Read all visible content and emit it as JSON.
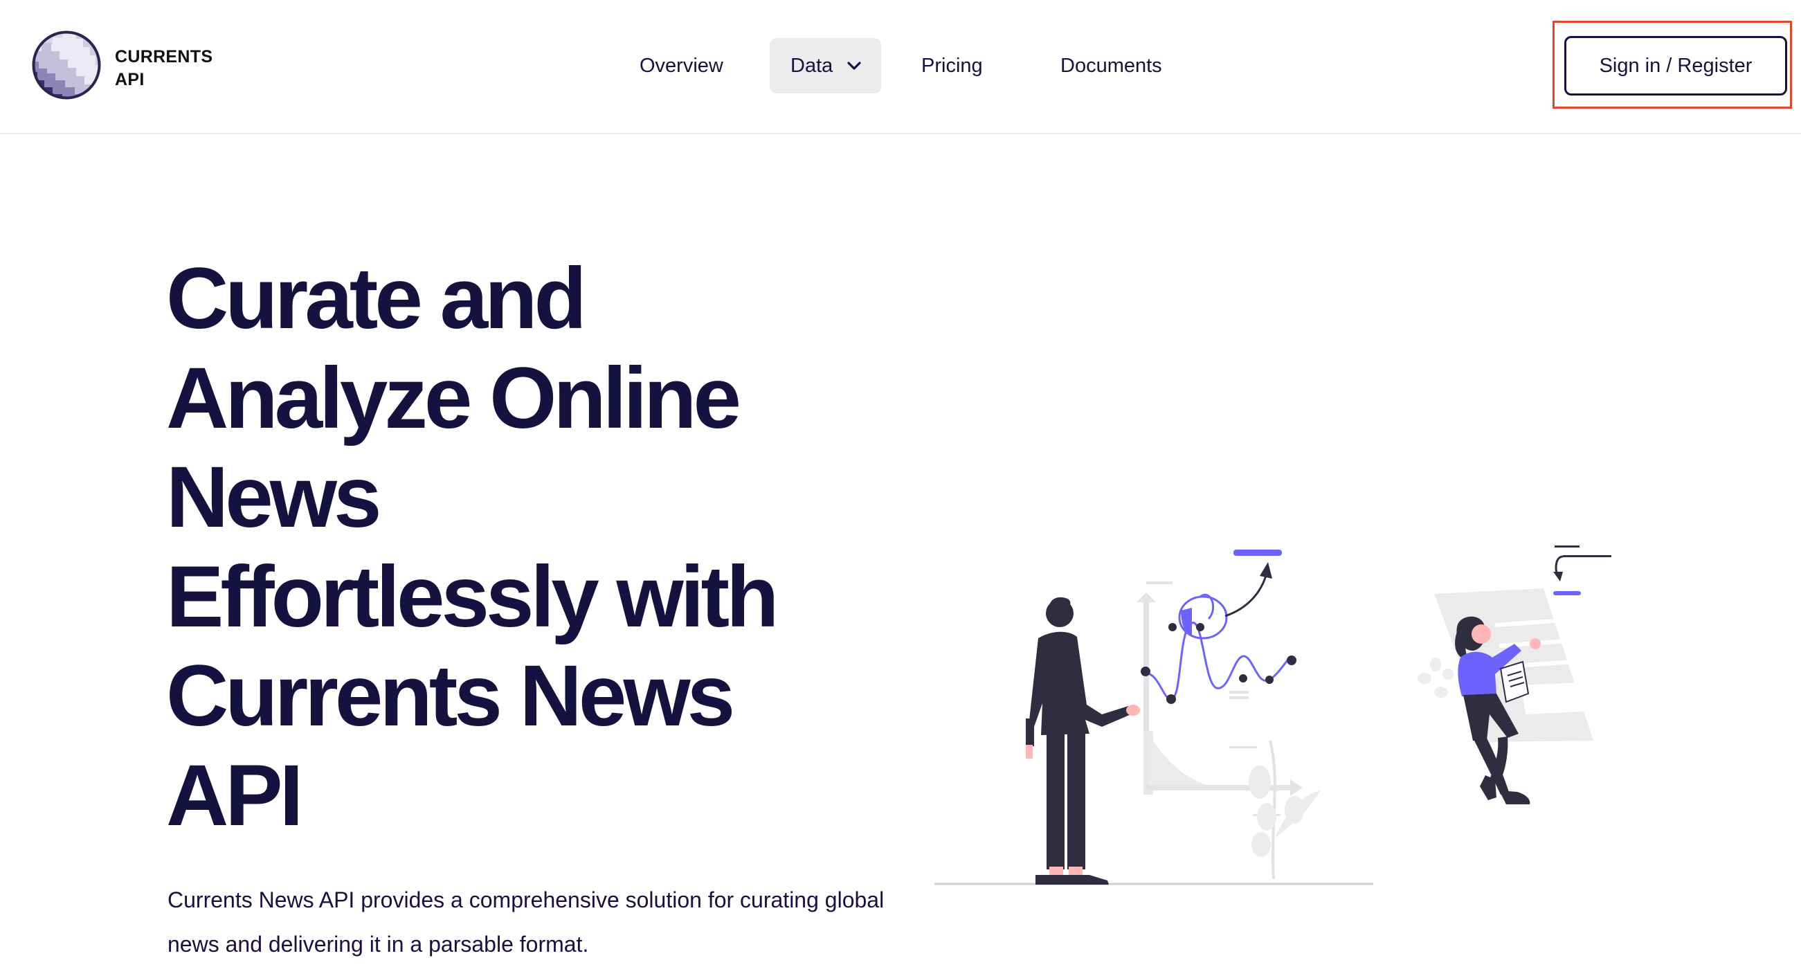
{
  "header": {
    "logo": {
      "line1": "CURRENTS",
      "line2": "API"
    },
    "nav": {
      "overview": "Overview",
      "data": "Data",
      "pricing": "Pricing",
      "documents": "Documents"
    },
    "signin_label": "Sign in / Register"
  },
  "hero": {
    "title_lines": [
      "Curate and",
      "Analyze Online",
      "News",
      "Effortlessly with",
      "Currents News",
      "API"
    ],
    "description": "Currents News API provides a comprehensive solution for curating global news and delivering it in a parsable format."
  },
  "colors": {
    "brand_dark": "#15123f",
    "accent_purple": "#6c63ff",
    "highlight_red": "#e2472a",
    "nav_active_bg": "#ececed"
  },
  "icons": {
    "logo": "currents-globe-logo",
    "data_dropdown": "chevron-down-icon",
    "illustration": "data-analysis-illustration"
  }
}
